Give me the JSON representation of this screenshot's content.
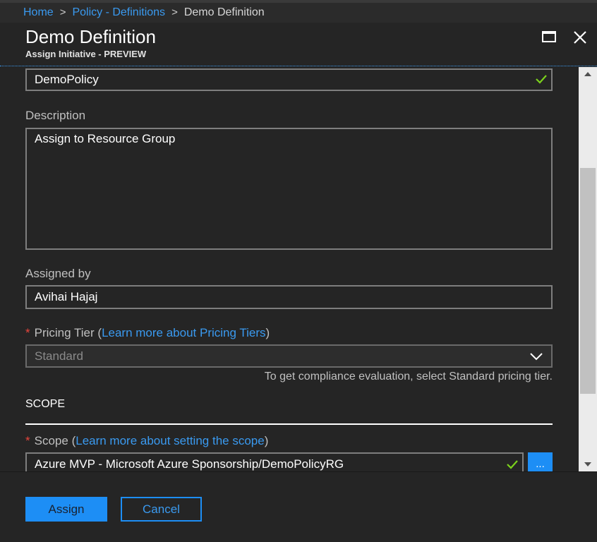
{
  "breadcrumb": {
    "items": [
      "Home",
      "Policy - Definitions",
      "Demo Definition"
    ],
    "separator": ">"
  },
  "blade": {
    "title": "Demo Definition",
    "subtitle": "Assign Initiative - PREVIEW"
  },
  "form": {
    "assignment_name": {
      "value": "DemoPolicy"
    },
    "description": {
      "label": "Description",
      "value": "Assign to Resource Group"
    },
    "assigned_by": {
      "label": "Assigned by",
      "value": "Avihai Hajaj"
    },
    "pricing_tier": {
      "required_marker": "*",
      "label": "Pricing Tier",
      "open_paren": "(",
      "link": "Learn more about Pricing Tiers",
      "close_paren": ")",
      "value": "Standard",
      "hint": "To get compliance evaluation, select Standard pricing tier."
    },
    "scope_section": {
      "heading": "SCOPE"
    },
    "scope": {
      "required_marker": "*",
      "label": "Scope",
      "open_paren": "(",
      "link": "Learn more about setting the scope",
      "close_paren": ")",
      "value": "Azure MVP - Microsoft Azure Sponsorship/DemoPolicyRG",
      "browse_label": "..."
    }
  },
  "footer": {
    "assign_label": "Assign",
    "cancel_label": "Cancel"
  },
  "colors": {
    "accent": "#1d8ef5",
    "link": "#3a9af0",
    "valid_check": "#7bd21c",
    "required": "#e6453c",
    "background": "#252525"
  },
  "icons": [
    "chevron-right-icon",
    "maximize-icon",
    "close-icon",
    "checkmark-icon",
    "chevron-down-icon",
    "scroll-up-icon",
    "scroll-down-icon"
  ]
}
